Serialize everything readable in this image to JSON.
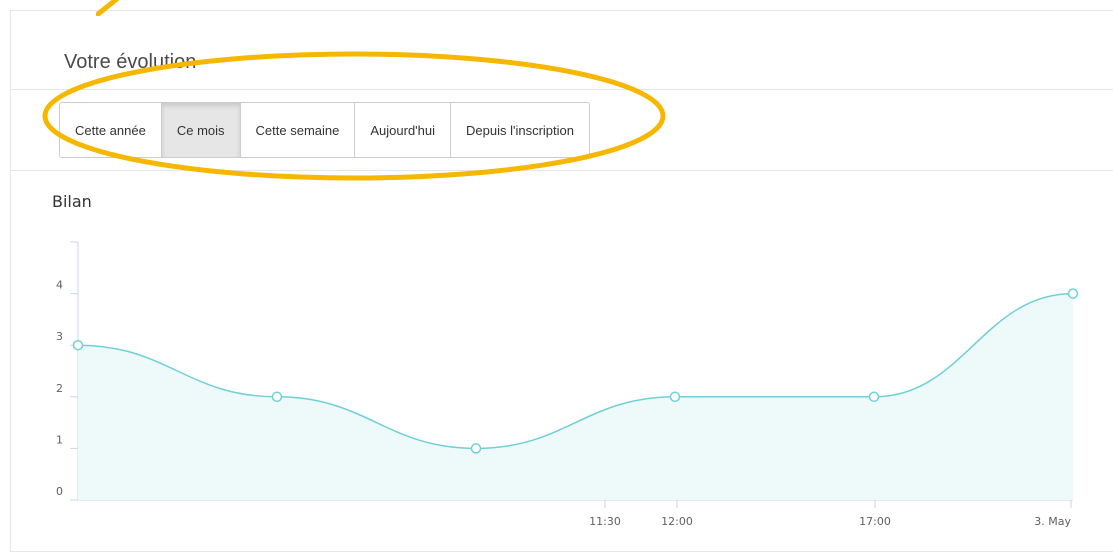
{
  "panel": {
    "title": "Votre évolution"
  },
  "filters": [
    {
      "label": "Cette année",
      "active": false
    },
    {
      "label": "Ce mois",
      "active": true
    },
    {
      "label": "Cette semaine",
      "active": false
    },
    {
      "label": "Aujourd'hui",
      "active": false
    },
    {
      "label": "Depuis l'inscription",
      "active": false
    }
  ],
  "colors": {
    "highlight": "#f5b700",
    "series_line": "#6fd0d8",
    "series_fill": "#eef9fa",
    "axis": "#ccd6eb"
  },
  "chart_data": {
    "type": "area",
    "title": "Bilan",
    "xlabel": "",
    "ylabel": "",
    "ylim": [
      0,
      5
    ],
    "y_ticks": [
      "0",
      "1",
      "2",
      "3",
      "4"
    ],
    "x_tick_labels": [
      "11:30",
      "12:00",
      "17:00",
      "3. May"
    ],
    "series": [
      {
        "values": [
          3,
          2,
          1,
          2,
          2,
          4
        ]
      }
    ],
    "grid": false,
    "legend": "none"
  }
}
